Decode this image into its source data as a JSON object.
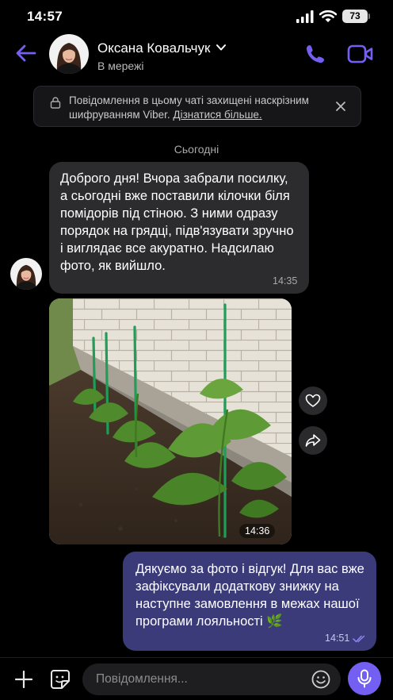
{
  "status_bar": {
    "time": "14:57",
    "battery": "73"
  },
  "header": {
    "contact_name": "Оксана Ковальчук",
    "status": "В мережі"
  },
  "banner": {
    "text": "Повідомлення в цьому чаті захищені наскрізним шифруванням Viber.",
    "link": "Дізнатися більше."
  },
  "date_separator": "Сьогодні",
  "messages": {
    "incoming_text": "Доброго дня! Вчора забрали посилку, а сьогодні вже поставили кілочки біля помідорів під стіною. З ними одразу порядок на грядці, підв'язувати зручно і виглядає все акуратно. Надсилаю фото, як вийшло.",
    "incoming_time": "14:35",
    "photo_time": "14:36",
    "outgoing_text": "Дякуємо за фото і відгук! Для вас вже зафіксували додаткову знижку на наступне замовлення в межах нашої програми лояльності 🌿",
    "outgoing_time": "14:51"
  },
  "composer": {
    "placeholder": "Повідомлення..."
  },
  "colors": {
    "accent": "#7360f2",
    "outgoing_bubble": "#3a3b78",
    "incoming_bubble": "#2c2c2e"
  }
}
